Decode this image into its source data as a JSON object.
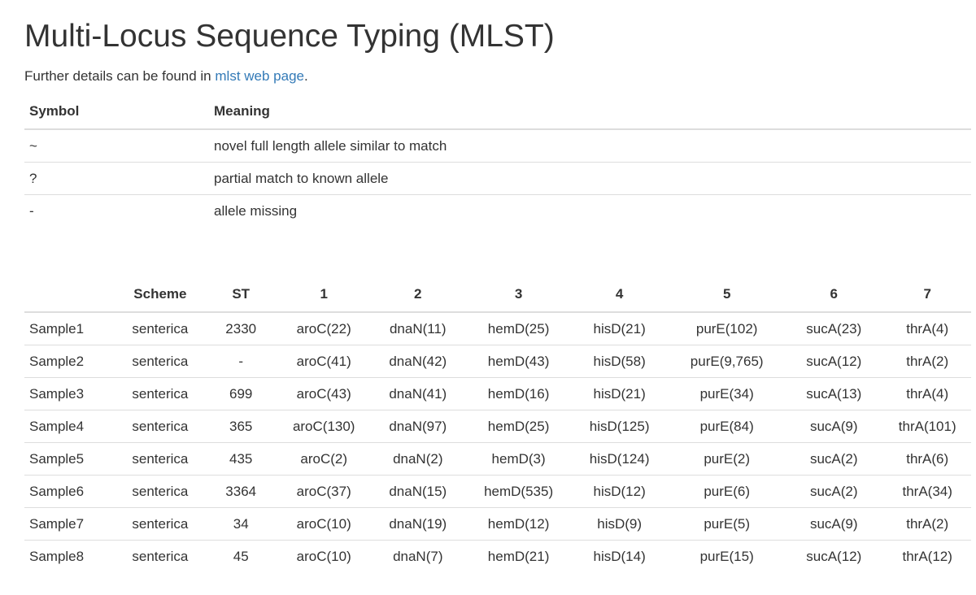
{
  "page": {
    "title": "Multi-Locus Sequence Typing (MLST)",
    "intro_prefix": "Further details can be found in ",
    "intro_link": "mlst web page",
    "intro_suffix": "."
  },
  "legend": {
    "headers": [
      "Symbol",
      "Meaning"
    ],
    "rows": [
      [
        "~",
        "novel full length allele similar to match"
      ],
      [
        "?",
        "partial match to known allele"
      ],
      [
        "-",
        "allele missing"
      ]
    ]
  },
  "mlst": {
    "headers": [
      "",
      "Scheme",
      "ST",
      "1",
      "2",
      "3",
      "4",
      "5",
      "6",
      "7"
    ],
    "rows": [
      [
        "Sample1",
        "senterica",
        "2330",
        "aroC(22)",
        "dnaN(11)",
        "hemD(25)",
        "hisD(21)",
        "purE(102)",
        "sucA(23)",
        "thrA(4)"
      ],
      [
        "Sample2",
        "senterica",
        "-",
        "aroC(41)",
        "dnaN(42)",
        "hemD(43)",
        "hisD(58)",
        "purE(9,765)",
        "sucA(12)",
        "thrA(2)"
      ],
      [
        "Sample3",
        "senterica",
        "699",
        "aroC(43)",
        "dnaN(41)",
        "hemD(16)",
        "hisD(21)",
        "purE(34)",
        "sucA(13)",
        "thrA(4)"
      ],
      [
        "Sample4",
        "senterica",
        "365",
        "aroC(130)",
        "dnaN(97)",
        "hemD(25)",
        "hisD(125)",
        "purE(84)",
        "sucA(9)",
        "thrA(101)"
      ],
      [
        "Sample5",
        "senterica",
        "435",
        "aroC(2)",
        "dnaN(2)",
        "hemD(3)",
        "hisD(124)",
        "purE(2)",
        "sucA(2)",
        "thrA(6)"
      ],
      [
        "Sample6",
        "senterica",
        "3364",
        "aroC(37)",
        "dnaN(15)",
        "hemD(535)",
        "hisD(12)",
        "purE(6)",
        "sucA(2)",
        "thrA(34)"
      ],
      [
        "Sample7",
        "senterica",
        "34",
        "aroC(10)",
        "dnaN(19)",
        "hemD(12)",
        "hisD(9)",
        "purE(5)",
        "sucA(9)",
        "thrA(2)"
      ],
      [
        "Sample8",
        "senterica",
        "45",
        "aroC(10)",
        "dnaN(7)",
        "hemD(21)",
        "hisD(14)",
        "purE(15)",
        "sucA(12)",
        "thrA(12)"
      ]
    ]
  }
}
